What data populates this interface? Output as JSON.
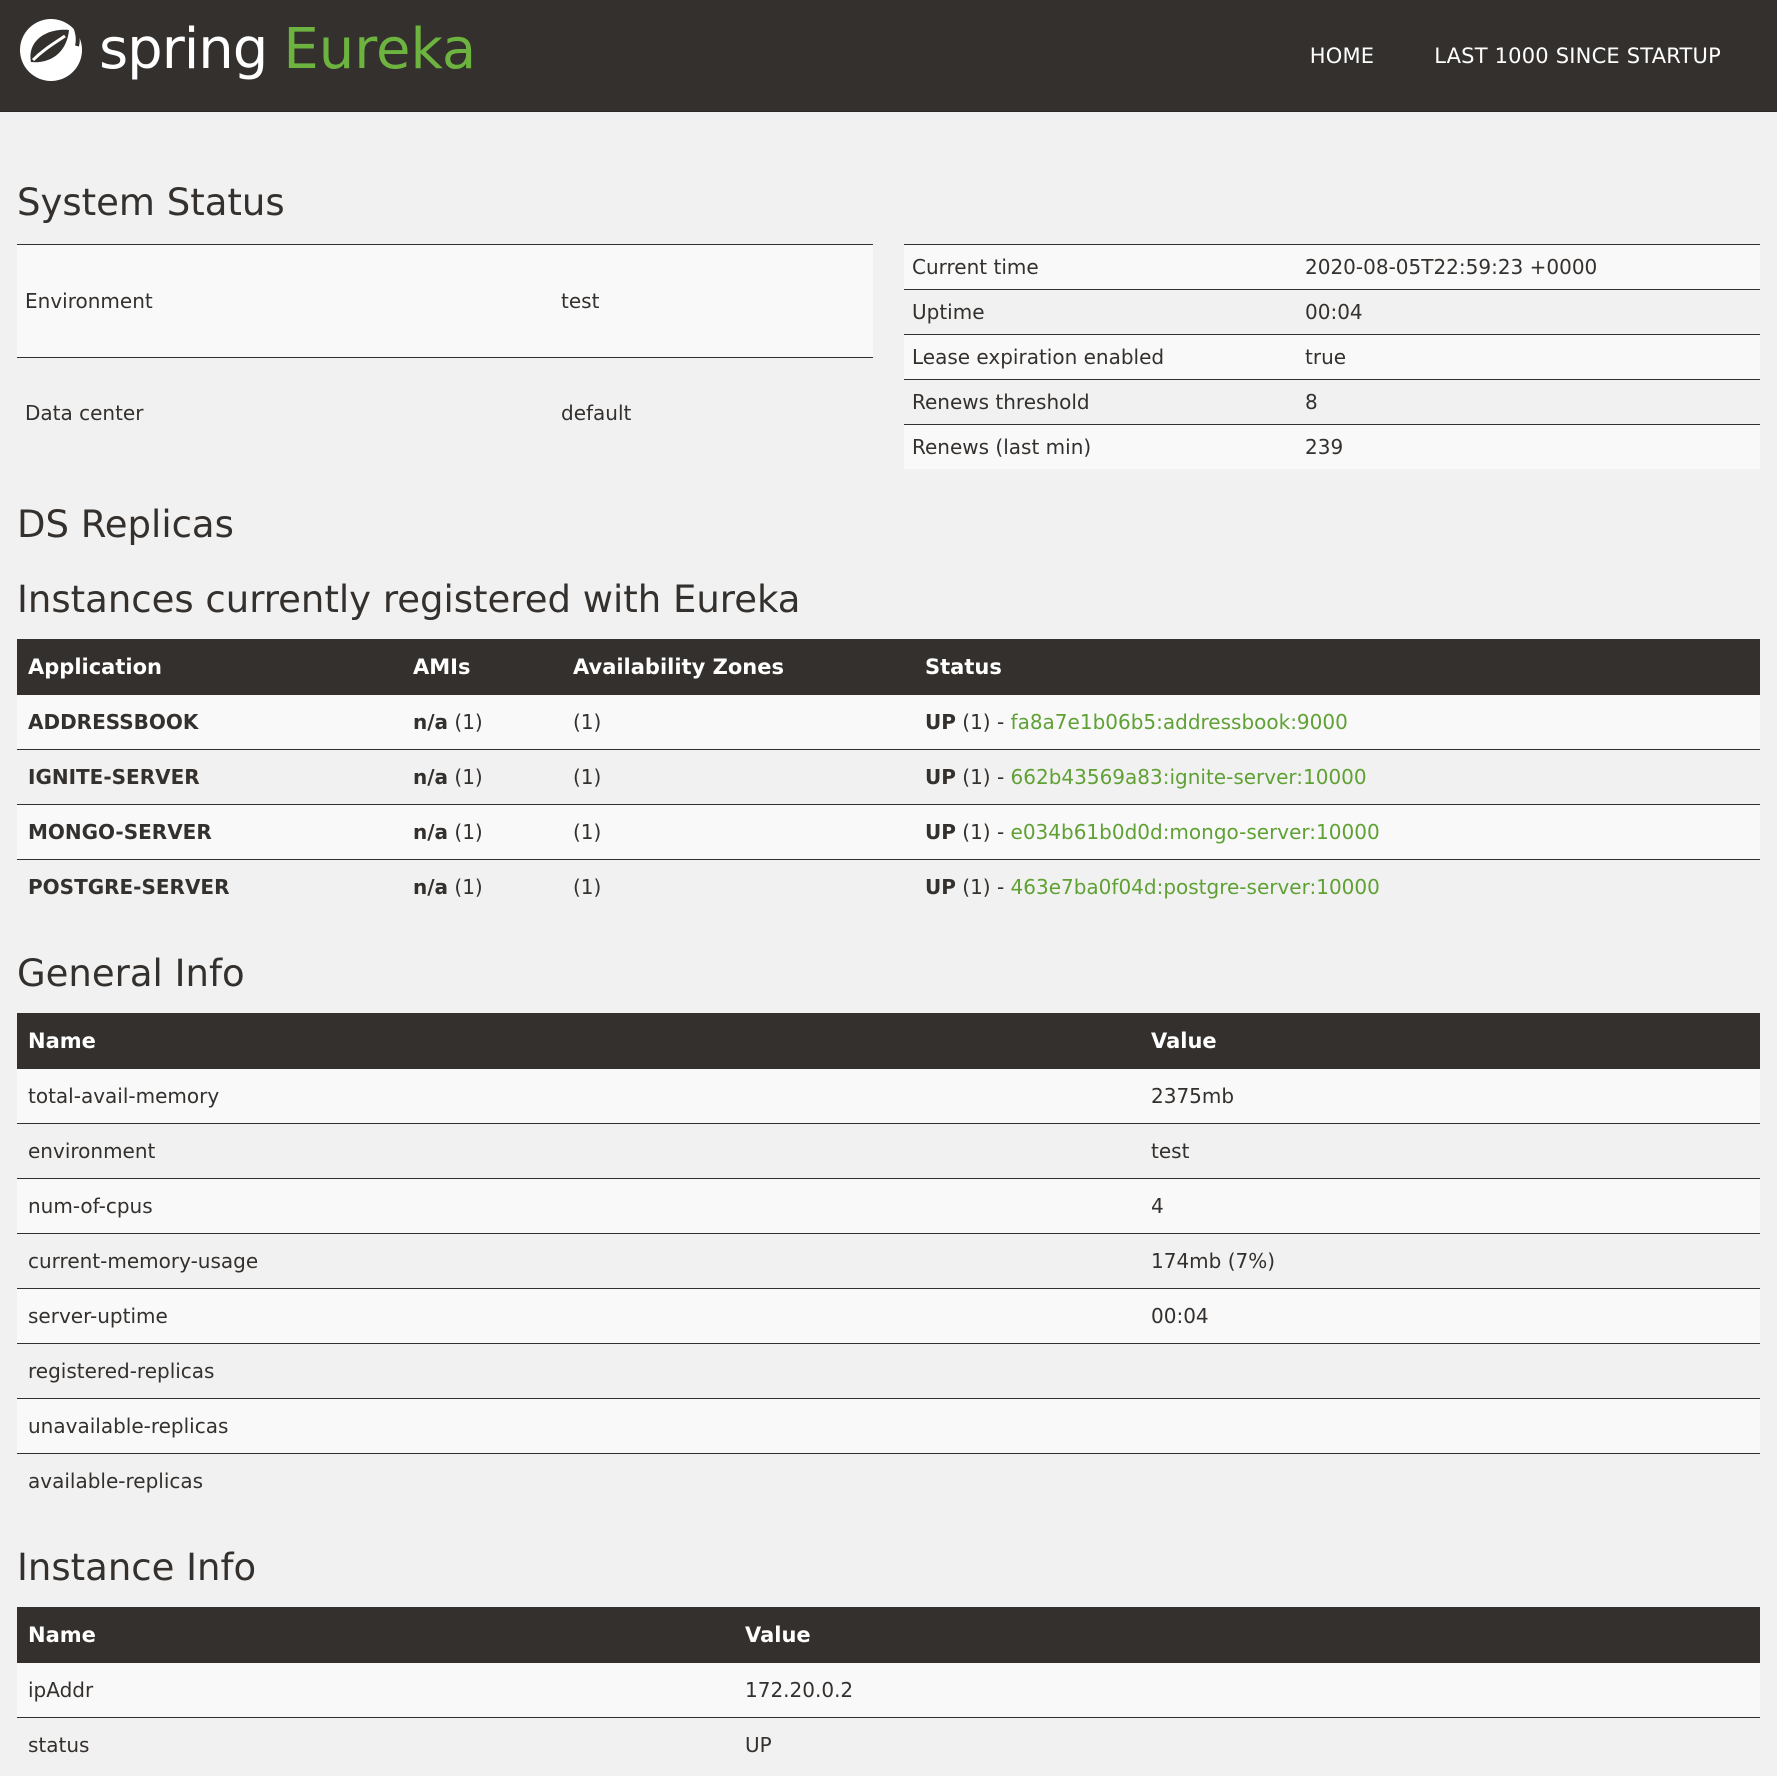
{
  "header": {
    "brand_spring": "spring",
    "brand_eureka": "Eureka",
    "nav": [
      "HOME",
      "LAST 1000 SINCE STARTUP"
    ]
  },
  "colors": {
    "navbar_bg": "#34302d",
    "accent_green": "#6db33f",
    "page_bg": "#f1f1f1"
  },
  "system_status": {
    "title": "System Status",
    "left": [
      {
        "label": "Environment",
        "value": "test"
      },
      {
        "label": "Data center",
        "value": "default"
      }
    ],
    "right": [
      {
        "label": "Current time",
        "value": "2020-08-05T22:59:23 +0000"
      },
      {
        "label": "Uptime",
        "value": "00:04"
      },
      {
        "label": "Lease expiration enabled",
        "value": "true"
      },
      {
        "label": "Renews threshold",
        "value": "8"
      },
      {
        "label": "Renews (last min)",
        "value": "239"
      }
    ]
  },
  "ds_replicas": {
    "title": "DS Replicas"
  },
  "instances": {
    "title": "Instances currently registered with Eureka",
    "columns": [
      "Application",
      "AMIs",
      "Availability Zones",
      "Status"
    ],
    "rows": [
      {
        "app": "ADDRESSBOOK",
        "ami_bold": "n/a",
        "ami_count": " (1)",
        "zones": "(1)",
        "status_bold": "UP",
        "status_rest": " (1) - ",
        "link": "fa8a7e1b06b5:addressbook:9000"
      },
      {
        "app": "IGNITE-SERVER",
        "ami_bold": "n/a",
        "ami_count": " (1)",
        "zones": "(1)",
        "status_bold": "UP",
        "status_rest": " (1) - ",
        "link": "662b43569a83:ignite-server:10000"
      },
      {
        "app": "MONGO-SERVER",
        "ami_bold": "n/a",
        "ami_count": " (1)",
        "zones": "(1)",
        "status_bold": "UP",
        "status_rest": " (1) - ",
        "link": "e034b61b0d0d:mongo-server:10000"
      },
      {
        "app": "POSTGRE-SERVER",
        "ami_bold": "n/a",
        "ami_count": " (1)",
        "zones": "(1)",
        "status_bold": "UP",
        "status_rest": " (1) - ",
        "link": "463e7ba0f04d:postgre-server:10000"
      }
    ]
  },
  "general_info": {
    "title": "General Info",
    "columns": [
      "Name",
      "Value"
    ],
    "rows": [
      {
        "name": "total-avail-memory",
        "value": "2375mb"
      },
      {
        "name": "environment",
        "value": "test"
      },
      {
        "name": "num-of-cpus",
        "value": "4"
      },
      {
        "name": "current-memory-usage",
        "value": "174mb (7%)"
      },
      {
        "name": "server-uptime",
        "value": "00:04"
      },
      {
        "name": "registered-replicas",
        "value": ""
      },
      {
        "name": "unavailable-replicas",
        "value": ""
      },
      {
        "name": "available-replicas",
        "value": ""
      }
    ]
  },
  "instance_info": {
    "title": "Instance Info",
    "columns": [
      "Name",
      "Value"
    ],
    "rows": [
      {
        "name": "ipAddr",
        "value": "172.20.0.2"
      },
      {
        "name": "status",
        "value": "UP"
      }
    ]
  }
}
